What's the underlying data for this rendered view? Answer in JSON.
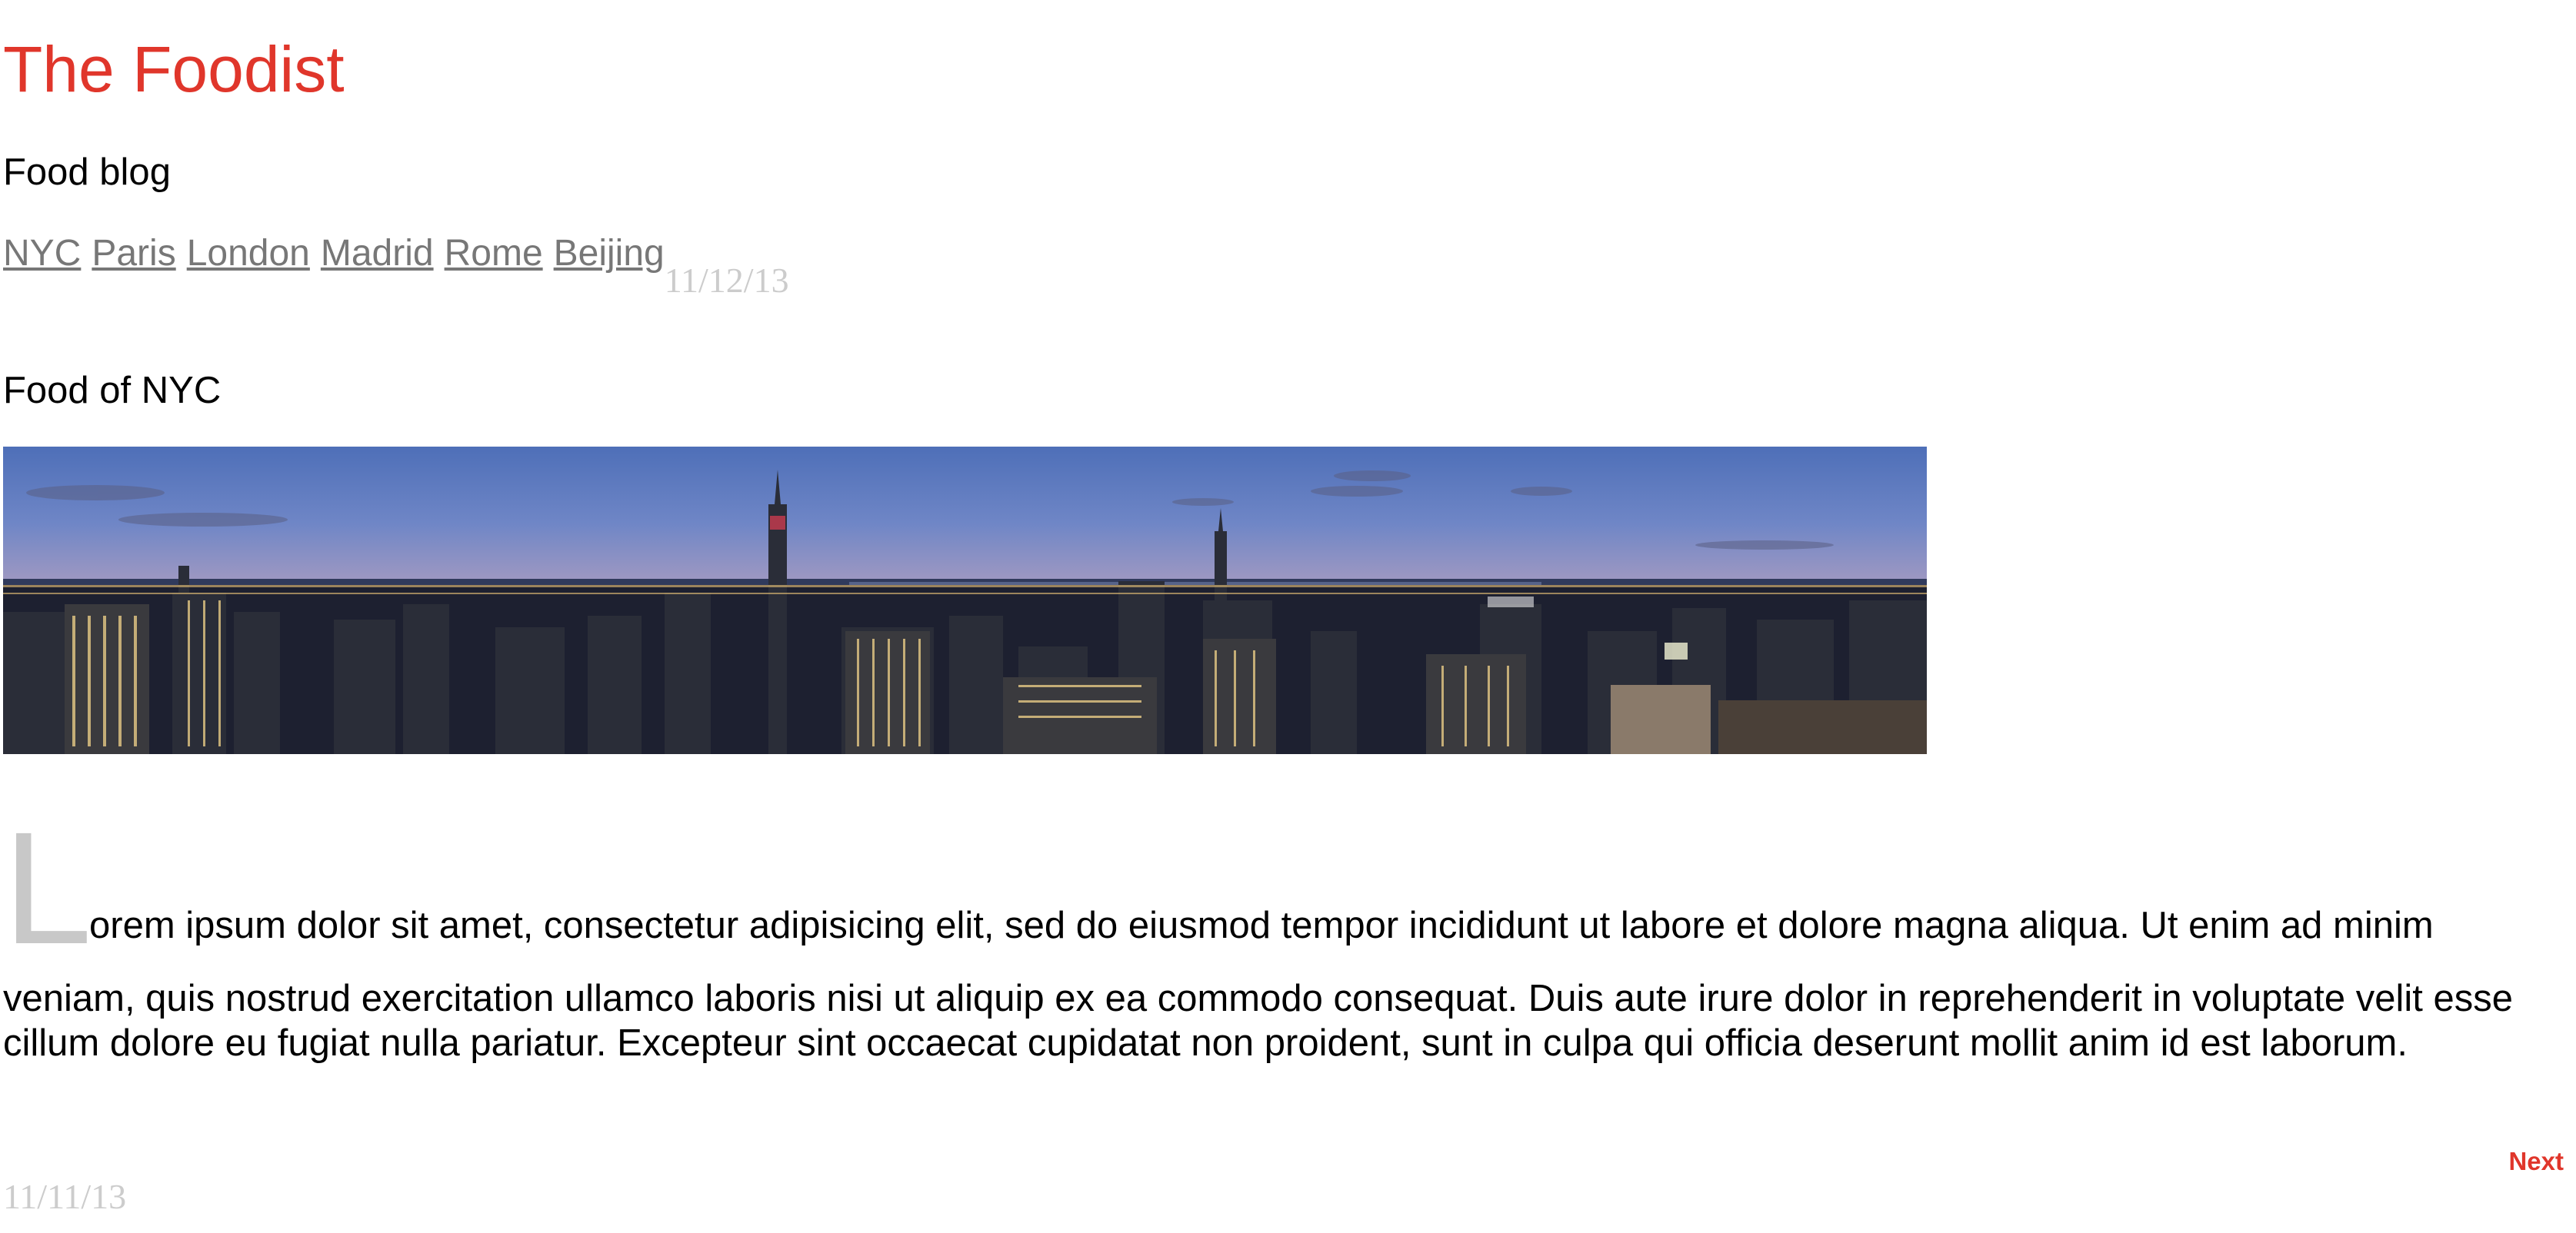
{
  "site": {
    "title": "The Foodist",
    "tagline": "Food blog",
    "accent_color": "#e0362b"
  },
  "nav": {
    "links": [
      "NYC",
      "Paris",
      "London",
      "Madrid",
      "Rome",
      "Beijing"
    ],
    "date": "11/12/13"
  },
  "post": {
    "heading": "Food of NYC",
    "image_alt": "Panoramic NYC skyline at dusk",
    "drop_cap": "L",
    "lead": "orem ipsum dolor sit amet, consectetur adipisicing elit, sed do eiusmod tempor incididunt ut labore et dolore magna aliqua. Ut enim ad minim",
    "body": "veniam, quis nostrud exercitation ullamco laboris nisi ut aliquip ex ea commodo consequat. Duis aute irure dolor in reprehenderit in voluptate velit esse cillum dolore eu fugiat nulla pariatur. Excepteur sint occaecat cupidatat non proident, sunt in culpa qui officia deserunt mollit anim id est laborum."
  },
  "pager": {
    "next_label": "Next"
  },
  "footer": {
    "date": "11/11/13"
  }
}
